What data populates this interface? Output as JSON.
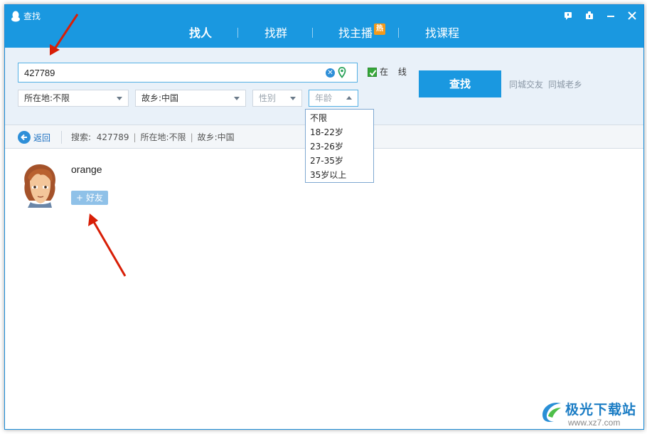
{
  "window": {
    "title": "查找"
  },
  "tabs": [
    {
      "label": "找人",
      "active": true
    },
    {
      "label": "找群",
      "active": false
    },
    {
      "label": "找主播",
      "badge": "热",
      "active": false
    },
    {
      "label": "找课程",
      "active": false
    }
  ],
  "search": {
    "value": "427789",
    "online_label": "在 线",
    "online_checked": true,
    "find_button": "查找",
    "links": [
      "同城交友",
      "同城老乡"
    ]
  },
  "filters": {
    "location": "所在地:不限",
    "hometown": "故乡:中国",
    "gender_placeholder": "性别",
    "age_placeholder": "年龄"
  },
  "age_dropdown": {
    "options": [
      "不限",
      "18-22岁",
      "23-26岁",
      "27-35岁",
      "35岁以上"
    ]
  },
  "breadcrumb": {
    "back_label": "返回",
    "search_prefix": "搜索:",
    "search_value": "427789",
    "location": "所在地:不限",
    "hometown": "故乡:中国"
  },
  "results": [
    {
      "name": "orange",
      "add_label": "好友"
    }
  ],
  "watermark": {
    "title": "极光下载站",
    "url": "www.xz7.com"
  },
  "colors": {
    "titlebar": "#1a98e0",
    "search_area_bg": "#e9f1f9",
    "accent_blue": "#1a98e0",
    "hot_badge": "#f39a1b",
    "annotation_red": "#d81e06"
  }
}
